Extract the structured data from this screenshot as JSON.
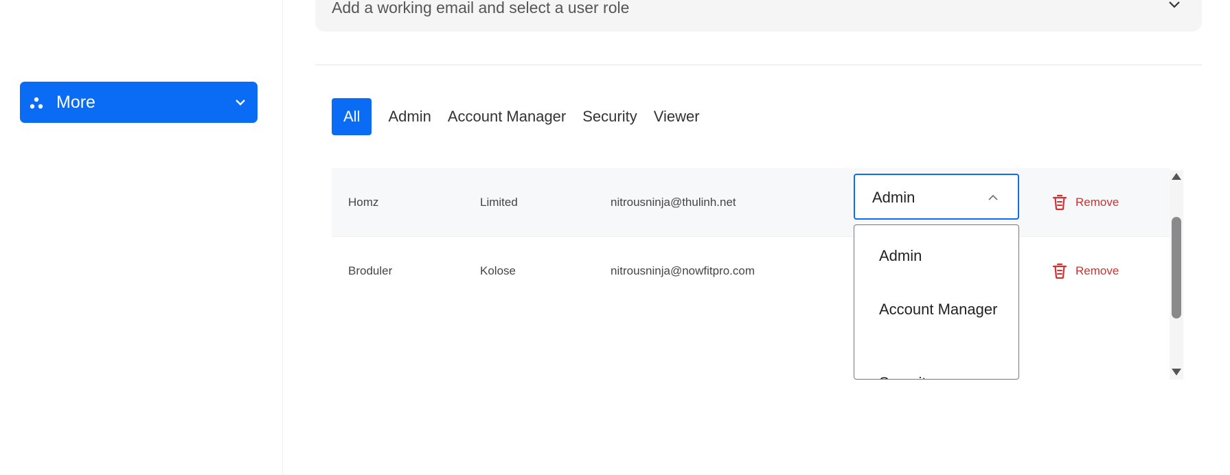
{
  "sidebar": {
    "more_label": "More"
  },
  "invite": {
    "text": "Add a working email and select a user role"
  },
  "tabs": [
    {
      "label": "All",
      "active": true
    },
    {
      "label": "Admin",
      "active": false
    },
    {
      "label": "Account Manager",
      "active": false
    },
    {
      "label": "Security",
      "active": false
    },
    {
      "label": "Viewer",
      "active": false
    }
  ],
  "users": [
    {
      "first": "Homz",
      "last": "Limited",
      "email": "nitrousninja@thulinh.net",
      "remove_label": "Remove"
    },
    {
      "first": "Broduler",
      "last": "Kolose",
      "email": "nitrousninja@nowfitpro.com",
      "remove_label": "Remove"
    }
  ],
  "role_select": {
    "value": "Admin",
    "options": [
      "Admin",
      "Account Manager",
      "Security"
    ]
  },
  "colors": {
    "accent": "#0a6cf5",
    "danger": "#d32f2f"
  }
}
